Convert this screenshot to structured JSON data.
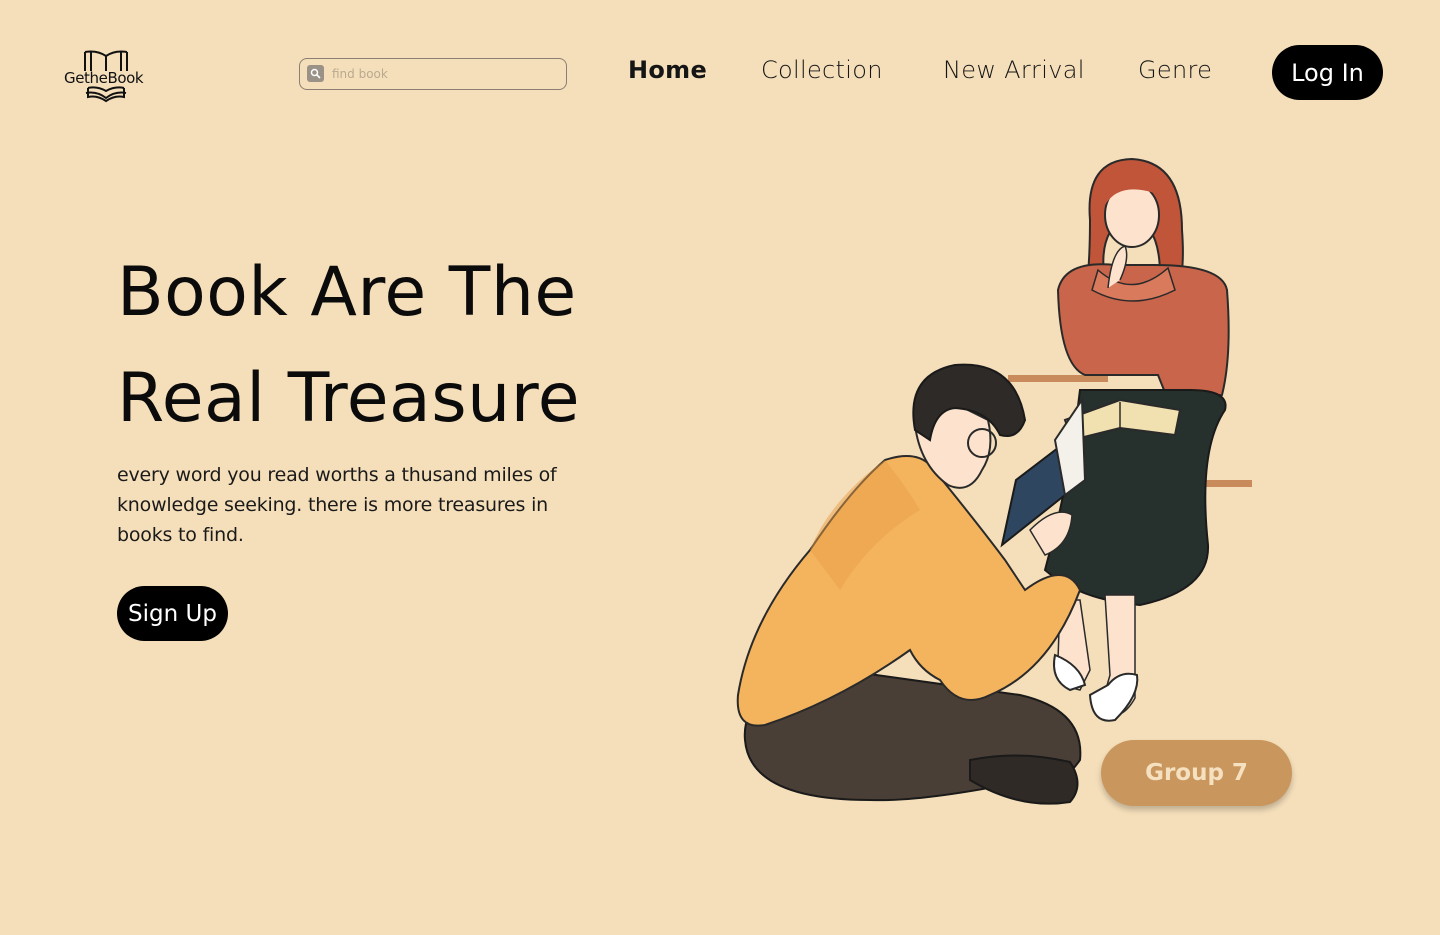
{
  "brand": {
    "name": "GetheBook",
    "logo_icon": "open-book-icon"
  },
  "search": {
    "placeholder": "find book",
    "icon": "search-icon"
  },
  "nav": {
    "items": [
      {
        "label": "Home",
        "active": true
      },
      {
        "label": "Collection",
        "active": false
      },
      {
        "label": "New Arrival",
        "active": false
      },
      {
        "label": "Genre",
        "active": false
      }
    ],
    "login_label": "Log In"
  },
  "hero": {
    "title_line1": "Book Are The",
    "title_line2": "Real Treasure",
    "description": "every word you read worths a thusand miles of knowledge seeking. there is more treasures in books to find.",
    "signup_label": "Sign Up"
  },
  "group_button": {
    "label": "Group 7"
  },
  "colors": {
    "background": "#f5dfba",
    "primary_button": "#000000",
    "group_button": "#c9965d",
    "group_button_text": "#f5e0c0"
  }
}
